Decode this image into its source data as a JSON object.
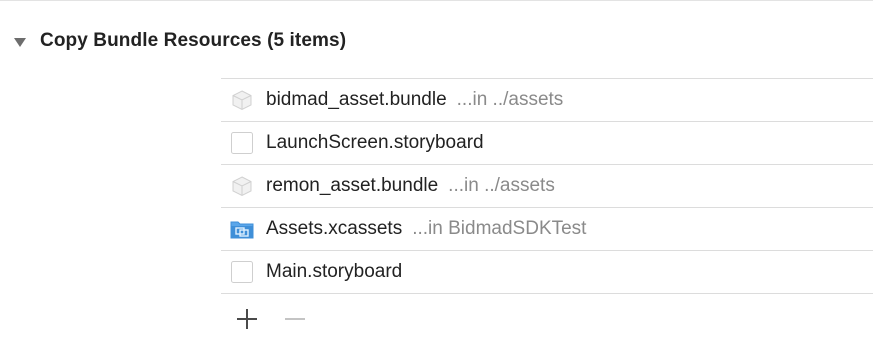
{
  "section": {
    "title": "Copy Bundle Resources (5 items)",
    "expanded": true
  },
  "files": [
    {
      "name": "bidmad_asset.bundle",
      "path": "...in ../assets",
      "icon": "bundle-icon"
    },
    {
      "name": "LaunchScreen.storyboard",
      "path": "",
      "icon": "storyboard-file-icon"
    },
    {
      "name": "remon_asset.bundle",
      "path": "...in ../assets",
      "icon": "bundle-icon"
    },
    {
      "name": "Assets.xcassets",
      "path": "...in BidmadSDKTest",
      "icon": "asset-catalog-icon"
    },
    {
      "name": "Main.storyboard",
      "path": "",
      "icon": "storyboard-file-icon"
    }
  ],
  "actions": {
    "add_symbol": "+",
    "remove_symbol": "−"
  },
  "colors": {
    "asset_catalog_blue": "#3f8fd8",
    "path_gray": "#8a8a8a",
    "divider": "#dcdcdc"
  }
}
